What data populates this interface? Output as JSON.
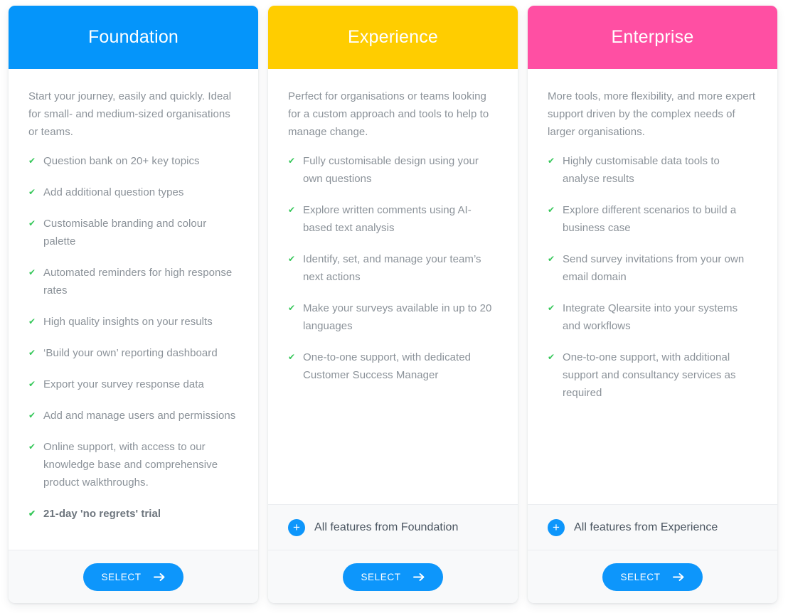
{
  "colors": {
    "foundation_header": "#0595fa",
    "experience_header": "#ffcd00",
    "enterprise_header": "#ff4fa3",
    "accent_blue": "#0d96fb",
    "check_green": "#35c759",
    "body_text": "#8b9299",
    "footer_bg": "#f8f9fa"
  },
  "plans": [
    {
      "id": "foundation",
      "title": "Foundation",
      "description": "Start your journey, easily and quickly. Ideal for small- and medium-sized organisations or teams.",
      "features": [
        {
          "text": "Question bank on 20+ key topics",
          "bold": false
        },
        {
          "text": "Add additional question types",
          "bold": false
        },
        {
          "text": "Customisable branding and colour palette",
          "bold": false
        },
        {
          "text": "Automated reminders for high response rates",
          "bold": false
        },
        {
          "text": "High quality insights on your results",
          "bold": false
        },
        {
          "text": "‘Build your own’ reporting dashboard",
          "bold": false
        },
        {
          "text": "Export your survey response data",
          "bold": false
        },
        {
          "text": "Add and manage users and permissions",
          "bold": false
        },
        {
          "text": "Online support, with access to our knowledge base and comprehensive product walkthroughs.",
          "bold": false
        },
        {
          "text": "21-day 'no regrets' trial",
          "bold": true
        }
      ],
      "includes": null,
      "select_label": "SELECT"
    },
    {
      "id": "experience",
      "title": "Experience",
      "description": "Perfect for organisations or teams looking for a custom approach and tools to help to manage change.",
      "features": [
        {
          "text": "Fully customisable design using your own questions",
          "bold": false
        },
        {
          "text": "Explore written comments using AI-based text analysis",
          "bold": false
        },
        {
          "text": "Identify, set, and manage your team’s next actions",
          "bold": false
        },
        {
          "text": "Make your surveys available in up to 20 languages",
          "bold": false
        },
        {
          "text": "One-to-one support, with dedicated Customer Success Manager",
          "bold": false
        }
      ],
      "includes": "All features from Foundation",
      "select_label": "SELECT"
    },
    {
      "id": "enterprise",
      "title": "Enterprise",
      "description": "More tools, more flexibility, and more expert support driven by the complex needs of larger organisations.",
      "features": [
        {
          "text": "Highly customisable data tools to analyse results",
          "bold": false
        },
        {
          "text": "Explore different scenarios to build a business case",
          "bold": false
        },
        {
          "text": "Send survey invitations from your own email domain",
          "bold": false
        },
        {
          "text": "Integrate Qlearsite into your systems and workflows",
          "bold": false
        },
        {
          "text": "One-to-one support, with additional support and consultancy services as required",
          "bold": false
        }
      ],
      "includes": "All features from Experience",
      "select_label": "SELECT"
    }
  ],
  "icons": {
    "check": "✔",
    "plus": "+",
    "arrow": "arrow-right-icon"
  }
}
